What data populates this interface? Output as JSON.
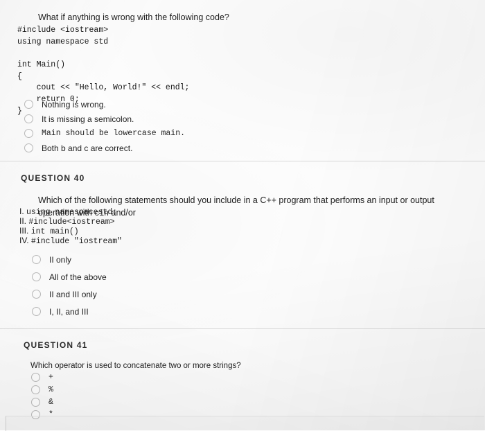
{
  "q39": {
    "prompt": "What if anything is wrong with the following code?",
    "code": "#include <iostream>\nusing namespace std\n\nint Main()\n{\n    cout << \"Hello, World!\" << endl;\n    return 0;\n}",
    "choices": [
      {
        "label": "Nothing is wrong.",
        "mono": false
      },
      {
        "label": "It is missing a semicolon.",
        "mono": false
      },
      {
        "label": "Main should be lowercase main.",
        "mono": true
      },
      {
        "label": "Both b and c are correct.",
        "mono": false
      }
    ]
  },
  "q40": {
    "heading": "QUESTION 40",
    "prompt_part1": "Which of the following statements should you include in a C++ program that performs an input or output operation with ",
    "prompt_code": "cin",
    "prompt_part2": " and/or",
    "statements": [
      {
        "numeral": "I.",
        "text": "using namespacestd;"
      },
      {
        "numeral": "II.",
        "text": "#include<iostream>"
      },
      {
        "numeral": "III.",
        "text": "int main()"
      },
      {
        "numeral": "IV.",
        "text": "#include \"iostream\""
      }
    ],
    "choices": [
      {
        "label": "II only"
      },
      {
        "label": "All of the above"
      },
      {
        "label": "II and III only"
      },
      {
        "label": "I, II, and III"
      }
    ]
  },
  "q41": {
    "heading": "QUESTION 41",
    "prompt": "Which operator is used to concatenate two or more strings?",
    "choices": [
      {
        "label": "+"
      },
      {
        "label": "%"
      },
      {
        "label": "&"
      },
      {
        "label": "*"
      }
    ]
  }
}
